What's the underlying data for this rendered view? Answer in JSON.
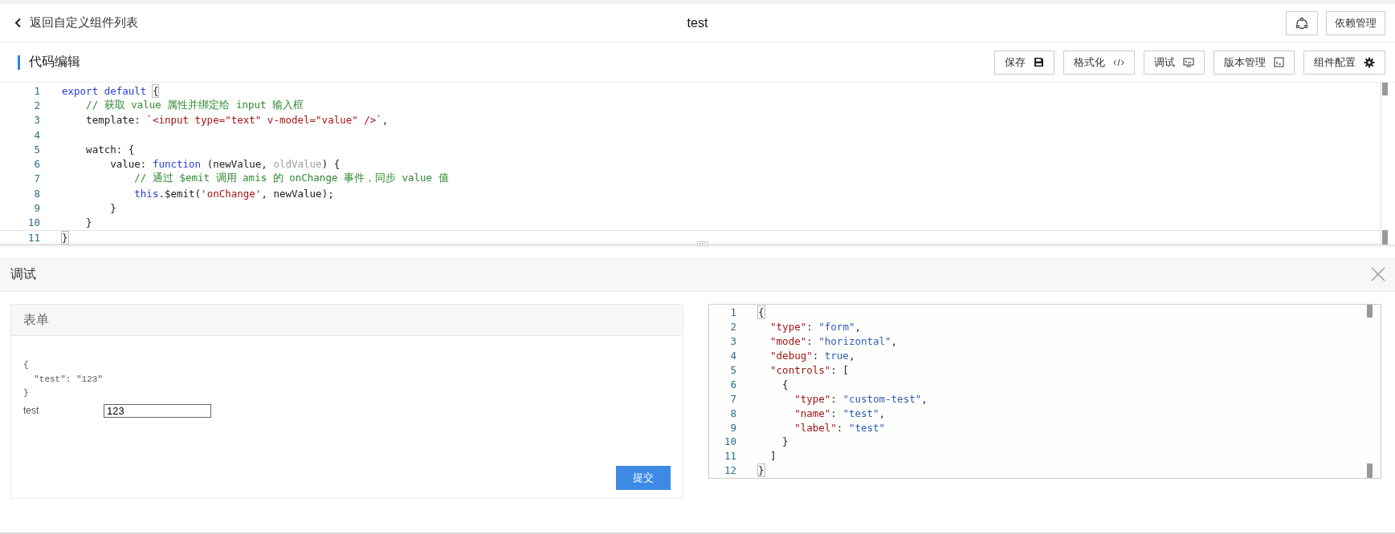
{
  "header": {
    "back_label": "返回自定义组件列表",
    "title": "test",
    "deps_button": "依赖管理"
  },
  "section": {
    "title": "代码编辑",
    "buttons": [
      {
        "kind": "save",
        "label": "保存"
      },
      {
        "kind": "format",
        "label": "格式化"
      },
      {
        "kind": "debug",
        "label": "调试"
      },
      {
        "kind": "version",
        "label": "版本管理"
      },
      {
        "kind": "config",
        "label": "组件配置"
      }
    ]
  },
  "code_editor": {
    "lines": [
      {
        "number": "1",
        "active": false,
        "tokens": [
          {
            "kind": "keyword",
            "text": "export default "
          },
          {
            "kind": "bracket",
            "text": "{"
          }
        ]
      },
      {
        "number": "2",
        "active": false,
        "tokens": [
          {
            "kind": "comment",
            "text": "    // 获取 value 属性并绑定给 input 输入框"
          }
        ]
      },
      {
        "number": "3",
        "active": false,
        "tokens": [
          {
            "kind": "plain",
            "text": "    template: "
          },
          {
            "kind": "string",
            "text": "`<input type=\"text\" v-model=\"value\" />`"
          },
          {
            "kind": "plain",
            "text": ","
          }
        ]
      },
      {
        "number": "4",
        "active": false
      },
      {
        "number": "5",
        "active": false,
        "tokens": [
          {
            "kind": "plain",
            "text": "    watch: {"
          }
        ]
      },
      {
        "number": "6",
        "active": false,
        "tokens": [
          {
            "kind": "plain",
            "text": "        value: "
          },
          {
            "kind": "keyword",
            "text": "function"
          },
          {
            "kind": "plain",
            "text": " (newValue, "
          },
          {
            "kind": "muted",
            "text": "oldValue"
          },
          {
            "kind": "plain",
            "text": ") {"
          }
        ]
      },
      {
        "number": "7",
        "active": false,
        "tokens": [
          {
            "kind": "comment",
            "text": "            // 通过 $emit 调用 amis 的 onChange 事件，同步 value 值"
          }
        ]
      },
      {
        "number": "8",
        "active": false,
        "tokens": [
          {
            "kind": "keyword",
            "text": "            this"
          },
          {
            "kind": "plain",
            "text": ".$emit("
          },
          {
            "kind": "string",
            "text": "'onChange'"
          },
          {
            "kind": "plain",
            "text": ", newValue);"
          }
        ]
      },
      {
        "number": "9",
        "active": false,
        "tokens": [
          {
            "kind": "plain",
            "text": "        }"
          }
        ]
      },
      {
        "number": "10",
        "active": false,
        "tokens": [
          {
            "kind": "plain",
            "text": "    }"
          }
        ]
      },
      {
        "number": "11",
        "active": true,
        "tokens": [
          {
            "kind": "bracket",
            "text": "}"
          }
        ]
      }
    ]
  },
  "debug_panel": {
    "title": "调试",
    "form": {
      "title": "表单",
      "debug_output": "{\n  \"test\": \"123\"\n}",
      "field_label": "test",
      "field_value": "123",
      "submit": "提交"
    },
    "json_editor": {
      "lines": [
        {
          "number": "1",
          "tokens": [
            {
              "kind": "bracket",
              "text": "{"
            }
          ]
        },
        {
          "number": "2",
          "tokens": [
            {
              "kind": "key",
              "text": "  \"type\""
            },
            {
              "kind": "plain",
              "text": ": "
            },
            {
              "kind": "value",
              "text": "\"form\""
            },
            {
              "kind": "plain",
              "text": ","
            }
          ]
        },
        {
          "number": "3",
          "tokens": [
            {
              "kind": "key",
              "text": "  \"mode\""
            },
            {
              "kind": "plain",
              "text": ": "
            },
            {
              "kind": "value",
              "text": "\"horizontal\""
            },
            {
              "kind": "plain",
              "text": ","
            }
          ]
        },
        {
          "number": "4",
          "tokens": [
            {
              "kind": "key",
              "text": "  \"debug\""
            },
            {
              "kind": "plain",
              "text": ": "
            },
            {
              "kind": "value",
              "text": "true"
            },
            {
              "kind": "plain",
              "text": ","
            }
          ]
        },
        {
          "number": "5",
          "tokens": [
            {
              "kind": "key",
              "text": "  \"controls\""
            },
            {
              "kind": "plain",
              "text": ": ["
            }
          ]
        },
        {
          "number": "6",
          "tokens": [
            {
              "kind": "plain",
              "text": "    {"
            }
          ]
        },
        {
          "number": "7",
          "tokens": [
            {
              "kind": "key",
              "text": "      \"type\""
            },
            {
              "kind": "plain",
              "text": ": "
            },
            {
              "kind": "value",
              "text": "\"custom-test\""
            },
            {
              "kind": "plain",
              "text": ","
            }
          ]
        },
        {
          "number": "8",
          "tokens": [
            {
              "kind": "key",
              "text": "      \"name\""
            },
            {
              "kind": "plain",
              "text": ": "
            },
            {
              "kind": "value",
              "text": "\"test\""
            },
            {
              "kind": "plain",
              "text": ","
            }
          ]
        },
        {
          "number": "9",
          "tokens": [
            {
              "kind": "key",
              "text": "      \"label\""
            },
            {
              "kind": "plain",
              "text": ": "
            },
            {
              "kind": "value",
              "text": "\"test\""
            }
          ]
        },
        {
          "number": "10",
          "tokens": [
            {
              "kind": "plain",
              "text": "    }"
            }
          ]
        },
        {
          "number": "11",
          "tokens": [
            {
              "kind": "plain",
              "text": "  ]"
            }
          ]
        },
        {
          "number": "12",
          "tokens": [
            {
              "kind": "bracket",
              "text": "}"
            }
          ]
        }
      ]
    }
  }
}
